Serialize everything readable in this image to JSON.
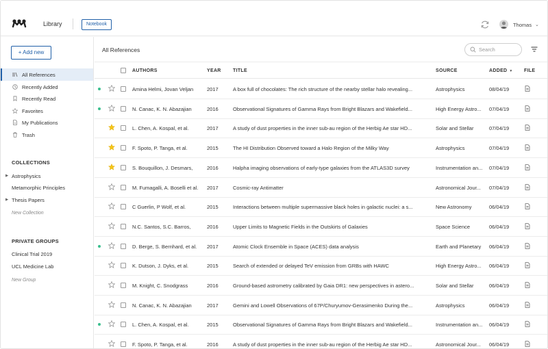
{
  "app": {
    "title": "Library",
    "notebook_label": "Notebook",
    "user_name": "Thomas"
  },
  "sidebar": {
    "add_new_label": "+ Add new",
    "nav": [
      {
        "label": "All References",
        "icon": "library-icon",
        "active": true
      },
      {
        "label": "Recently Added",
        "icon": "clock-icon",
        "active": false
      },
      {
        "label": "Recently Read",
        "icon": "bookmark-icon",
        "active": false
      },
      {
        "label": "Favorites",
        "icon": "star-icon",
        "active": false
      },
      {
        "label": "My Publications",
        "icon": "document-icon",
        "active": false
      },
      {
        "label": "Trash",
        "icon": "trash-icon",
        "active": false
      }
    ],
    "collections_heading": "COLLECTIONS",
    "collections": [
      {
        "label": "Astrophysics",
        "expandable": true
      },
      {
        "label": "Metamorphic Principles",
        "expandable": false
      },
      {
        "label": "Thesis Papers",
        "expandable": true
      }
    ],
    "new_collection_label": "New Collection",
    "groups_heading": "PRIVATE GROUPS",
    "groups": [
      {
        "label": "Clinical Trial 2019"
      },
      {
        "label": "UCL Medicine Lab"
      }
    ],
    "new_group_label": "New Group"
  },
  "main": {
    "title": "All References",
    "search_placeholder": "Search",
    "columns": {
      "authors": "AUTHORS",
      "year": "YEAR",
      "title": "TITLE",
      "source": "SOURCE",
      "added": "ADDED",
      "file": "FILE"
    },
    "accent_color": "#1f5fa8",
    "unread_dot_color": "#3bbf8e",
    "star_color": "#f5c518",
    "rows": [
      {
        "unread": true,
        "starred": false,
        "authors": "Amina Helmi, Jovan Veljan",
        "year": "2017",
        "title": "A box full of chocolates: The rich structure of the nearby stellar halo revealing...",
        "source": "Astrophysics",
        "added": "08/04/19"
      },
      {
        "unread": true,
        "starred": false,
        "authors": "N. Canac, K. N. Abazajian",
        "year": "2016",
        "title": "Observational Signatures of Gamma Rays from Bright Blazars and Wakefield...",
        "source": "High Energy Astro...",
        "added": "07/04/19"
      },
      {
        "unread": false,
        "starred": true,
        "authors": "L. Chen, A. Kospal, et al.",
        "year": "2017",
        "title": "A study of dust properties in the inner sub-au region of the Herbig Ae star HD...",
        "source": "Solar and Stellar",
        "added": "07/04/19"
      },
      {
        "unread": false,
        "starred": true,
        "authors": "F. Spoto, P. Tanga, et al.",
        "year": "2015",
        "title": "The HI Distribution Observed toward a Halo Region of the Milky Way",
        "source": "Astrophysics",
        "added": "07/04/19"
      },
      {
        "unread": false,
        "starred": true,
        "authors": "S. Bouquillon, J. Desmars,",
        "year": "2016",
        "title": "Halpha imaging observations of early-type galaxies from the ATLAS3D survey",
        "source": "Instrumentation an...",
        "added": "07/04/19"
      },
      {
        "unread": false,
        "starred": false,
        "authors": "M. Fumagalli, A. Boselli et al.",
        "year": "2017",
        "title": "Cosmic-ray Antimatter",
        "source": "Astronomical Jour...",
        "added": "07/04/19"
      },
      {
        "unread": false,
        "starred": false,
        "authors": "C Guerlin, P Wolf, et al.",
        "year": "2015",
        "title": "Interactions between multiple supermassive black holes in galactic nuclei: a s...",
        "source": "New Astronomy",
        "added": "06/04/19"
      },
      {
        "unread": false,
        "starred": false,
        "authors": "N.C. Santos, S.C. Barros,",
        "year": "2016",
        "title": "Upper Limits to Magnetic Fields in the Outskirts of Galaxies",
        "source": "Space Science",
        "added": "06/04/19"
      },
      {
        "unread": true,
        "starred": false,
        "authors": "D. Berge, S. Bernhard, et al.",
        "year": "2017",
        "title": "Atomic Clock Ensemble in Space (ACES) data analysis",
        "source": "Earth and Planetary",
        "added": "06/04/19"
      },
      {
        "unread": false,
        "starred": false,
        "authors": "K. Dutson, J. Dyks, et al.",
        "year": "2015",
        "title": "Search of extended or delayed TeV emission from GRBs with HAWC",
        "source": "High Energy Astro...",
        "added": "06/04/19"
      },
      {
        "unread": false,
        "starred": false,
        "authors": "M. Knight, C. Snodgrass",
        "year": "2016",
        "title": "Ground-based astrometry calibrated by Gaia DR1: new perspectives in astero...",
        "source": "Solar and Stellar",
        "added": "06/04/19"
      },
      {
        "unread": false,
        "starred": false,
        "authors": "N. Canac, K. N. Abazajian",
        "year": "2017",
        "title": "Gemini and Lowell Observations of 67P/Churyumov-Gerasimenko During the...",
        "source": "Astrophysics",
        "added": "06/04/19"
      },
      {
        "unread": true,
        "starred": false,
        "authors": "L. Chen, A. Kospal, et al.",
        "year": "2015",
        "title": "Observational Signatures of Gamma Rays from Bright Blazars and Wakefield...",
        "source": "Instrumentation an...",
        "added": "06/04/19"
      },
      {
        "unread": false,
        "starred": false,
        "authors": "F. Spoto, P. Tanga, et al.",
        "year": "2016",
        "title": "A study of dust properties in the inner sub-au region of the Herbig Ae star HD...",
        "source": "Astronomical Jour...",
        "added": "06/04/19"
      }
    ]
  }
}
